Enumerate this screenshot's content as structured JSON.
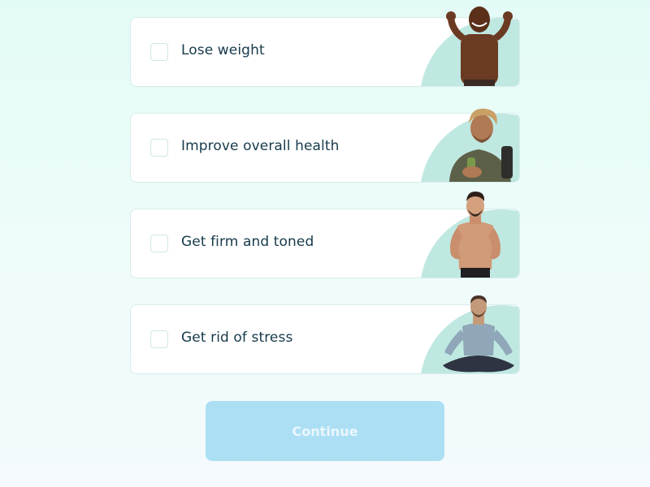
{
  "goals": [
    {
      "label": "Lose weight",
      "image": "man-flexing-shirtless-photo",
      "checked": false
    },
    {
      "label": "Improve overall health",
      "image": "man-with-backpack-drink-photo",
      "checked": false
    },
    {
      "label": "Get firm and toned",
      "image": "man-fit-torso-photo",
      "checked": false
    },
    {
      "label": "Get rid of stress",
      "image": "man-meditating-photo",
      "checked": false
    }
  ],
  "continue_label": "Continue",
  "colors": {
    "accent_blob": "#bfe8e1",
    "button_disabled": "#addff4",
    "text": "#163a4a"
  }
}
